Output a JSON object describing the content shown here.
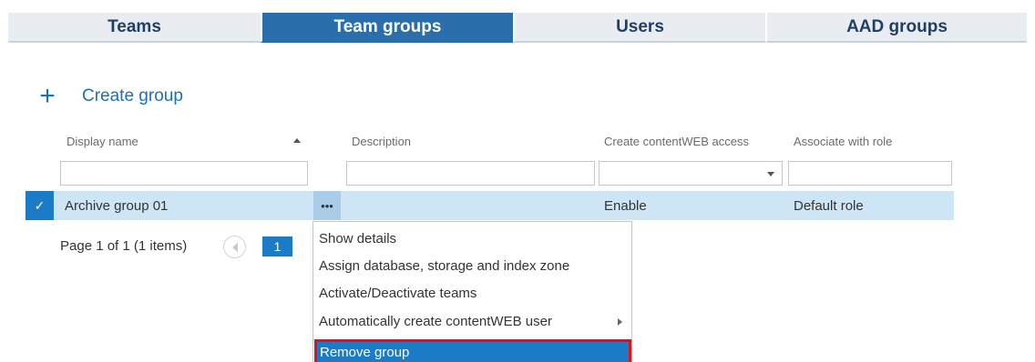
{
  "tabs": [
    {
      "label": "Teams",
      "active": false
    },
    {
      "label": "Team groups",
      "active": true
    },
    {
      "label": "Users",
      "active": false
    },
    {
      "label": "AAD groups",
      "active": false
    }
  ],
  "create": {
    "icon": "plus-icon",
    "label": "Create group"
  },
  "grid": {
    "columns": [
      {
        "label": "Display name",
        "sort": "ascending"
      },
      {
        "label": "Description"
      },
      {
        "label": "Create contentWEB access"
      },
      {
        "label": "Associate with role"
      }
    ],
    "filters": {
      "display_name": "",
      "description": "",
      "access": "",
      "role": ""
    },
    "rows": [
      {
        "display_name": "Archive group 01",
        "more": "•••",
        "description": "",
        "access": "Enable",
        "role": "Default role",
        "selected": true,
        "check": "✓"
      }
    ],
    "pager": {
      "text": "Page 1 of 1 (1 items)",
      "current": "1"
    }
  },
  "menu": {
    "items": [
      {
        "label": "Show details"
      },
      {
        "label": "Assign database, storage and index zone"
      },
      {
        "label": "Activate/Deactivate teams"
      },
      {
        "label": "Automatically create contentWEB user",
        "submenu": true
      },
      {
        "label": "Remove group",
        "highlighted": true
      }
    ]
  },
  "colors": {
    "accent": "#1c7bc6",
    "tab_active": "#2a6fac",
    "row_selected": "#cde5f5",
    "highlight_border": "#e3101a"
  }
}
